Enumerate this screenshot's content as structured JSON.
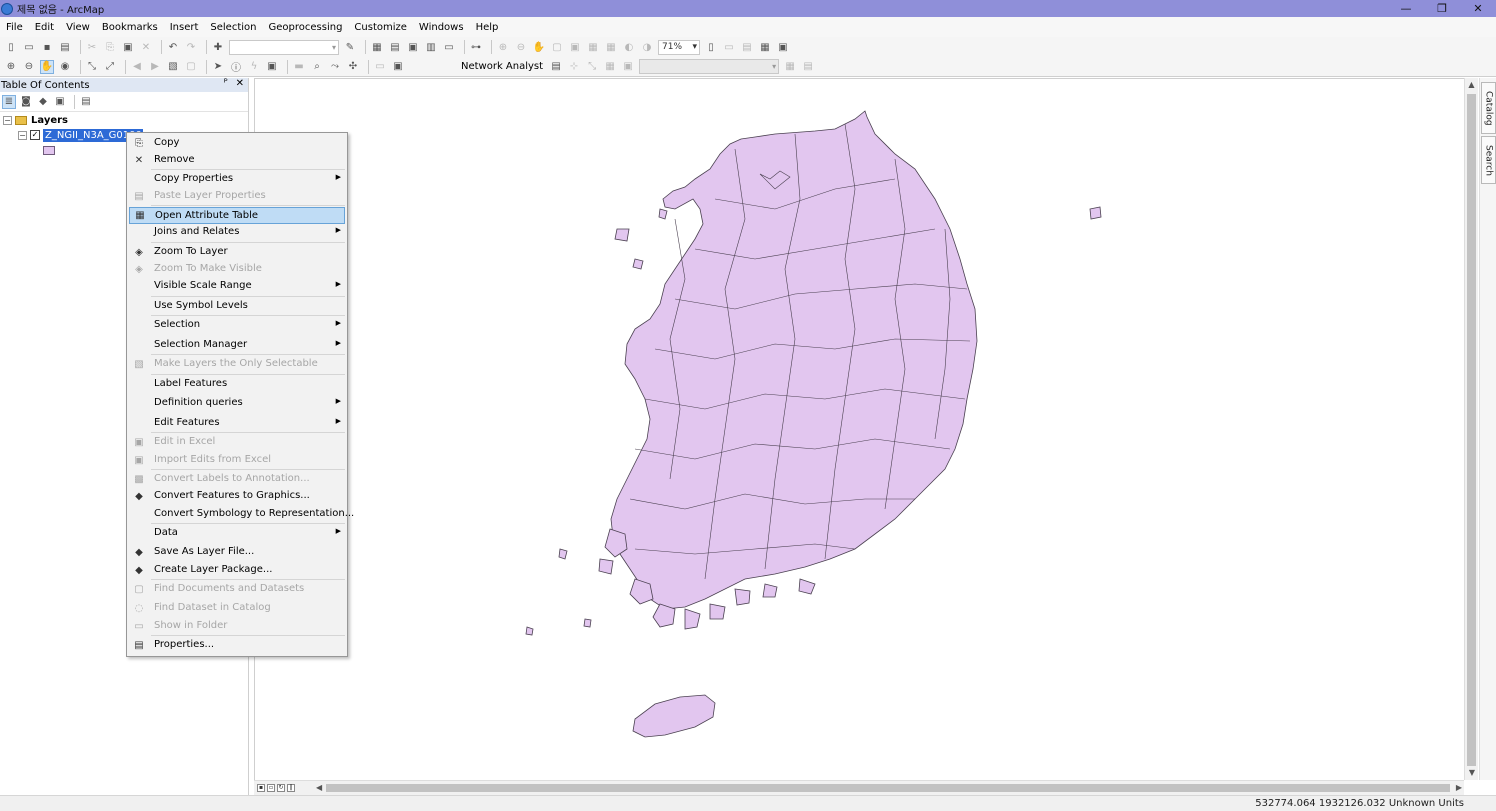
{
  "window": {
    "title": "제목 없음 - ArcMap",
    "controls": [
      "—",
      "❐",
      "✕"
    ]
  },
  "menubar": [
    "File",
    "Edit",
    "View",
    "Bookmarks",
    "Insert",
    "Selection",
    "Geoprocessing",
    "Customize",
    "Windows",
    "Help"
  ],
  "toolbar": {
    "zoom_level": "71%",
    "network_analyst_label": "Network Analyst"
  },
  "toc": {
    "title": "Table Of Contents",
    "pin": "ᴾ",
    "close": "✕",
    "root_label": "Layers",
    "layer_name": "Z_NGII_N3A_G0100000",
    "layer_checked": "✓",
    "map_fill": "#e2c6ef",
    "map_stroke": "#4a4050"
  },
  "context_menu": {
    "items": [
      {
        "label": "Copy",
        "icon": "copy-icon",
        "glyph": "⎘",
        "enabled": true,
        "submenu": false
      },
      {
        "label": "Remove",
        "icon": "remove-icon",
        "glyph": "✕",
        "enabled": true,
        "submenu": false
      },
      {
        "label": "Copy Properties",
        "icon": "",
        "glyph": "",
        "enabled": true,
        "submenu": true
      },
      {
        "label": "Paste Layer Properties",
        "icon": "paste-icon",
        "glyph": "▤",
        "enabled": false,
        "submenu": false
      },
      {
        "label": "Open Attribute Table",
        "icon": "table-icon",
        "glyph": "▦",
        "enabled": true,
        "submenu": false,
        "highlighted": true
      },
      {
        "label": "Joins and Relates",
        "icon": "",
        "glyph": "",
        "enabled": true,
        "submenu": true
      },
      {
        "label": "Zoom To Layer",
        "icon": "zoom-layer-icon",
        "glyph": "◈",
        "enabled": true,
        "submenu": false
      },
      {
        "label": "Zoom To Make Visible",
        "icon": "zoom-visible-icon",
        "glyph": "◈",
        "enabled": false,
        "submenu": false
      },
      {
        "label": "Visible Scale Range",
        "icon": "",
        "glyph": "",
        "enabled": true,
        "submenu": true
      },
      {
        "label": "Use Symbol Levels",
        "icon": "",
        "glyph": "",
        "enabled": true,
        "submenu": false
      },
      {
        "label": "Selection",
        "icon": "",
        "glyph": "",
        "enabled": true,
        "submenu": true
      },
      {
        "label": "Selection Manager",
        "icon": "",
        "glyph": "",
        "enabled": true,
        "submenu": true
      },
      {
        "label": "Make Layers the Only Selectable",
        "icon": "selectable-icon",
        "glyph": "▧",
        "enabled": false,
        "submenu": false
      },
      {
        "label": "Label Features",
        "icon": "",
        "glyph": "",
        "enabled": true,
        "submenu": false
      },
      {
        "label": "Definition queries",
        "icon": "",
        "glyph": "",
        "enabled": true,
        "submenu": true
      },
      {
        "label": "Edit Features",
        "icon": "",
        "glyph": "",
        "enabled": true,
        "submenu": true
      },
      {
        "label": "Edit in Excel",
        "icon": "excel-icon",
        "glyph": "▣",
        "enabled": false,
        "submenu": false
      },
      {
        "label": "Import Edits from Excel",
        "icon": "import-excel-icon",
        "glyph": "▣",
        "enabled": false,
        "submenu": false
      },
      {
        "label": "Convert Labels to Annotation...",
        "icon": "annotation-icon",
        "glyph": "▩",
        "enabled": false,
        "submenu": false
      },
      {
        "label": "Convert Features to Graphics...",
        "icon": "graphics-icon",
        "glyph": "◆",
        "enabled": true,
        "submenu": false
      },
      {
        "label": "Convert Symbology to Representation...",
        "icon": "",
        "glyph": "",
        "enabled": true,
        "submenu": false
      },
      {
        "label": "Data",
        "icon": "",
        "glyph": "",
        "enabled": true,
        "submenu": true
      },
      {
        "label": "Save As Layer File...",
        "icon": "layer-file-icon",
        "glyph": "◆",
        "enabled": true,
        "submenu": false
      },
      {
        "label": "Create Layer Package...",
        "icon": "layer-package-icon",
        "glyph": "◆",
        "enabled": true,
        "submenu": false
      },
      {
        "label": "Find Documents and Datasets",
        "icon": "find-docs-icon",
        "glyph": "▢",
        "enabled": false,
        "submenu": false
      },
      {
        "label": "Find Dataset in Catalog",
        "icon": "find-catalog-icon",
        "glyph": "◌",
        "enabled": false,
        "submenu": false
      },
      {
        "label": "Show in Folder",
        "icon": "folder-icon",
        "glyph": "▭",
        "enabled": false,
        "submenu": false
      },
      {
        "label": "Properties...",
        "icon": "properties-icon",
        "glyph": "▤",
        "enabled": true,
        "submenu": false
      }
    ]
  },
  "right_tabs": {
    "catalog": "Catalog",
    "search": "Search"
  },
  "status": {
    "coordinates": "532774.064  1932126.032 Unknown Units"
  }
}
